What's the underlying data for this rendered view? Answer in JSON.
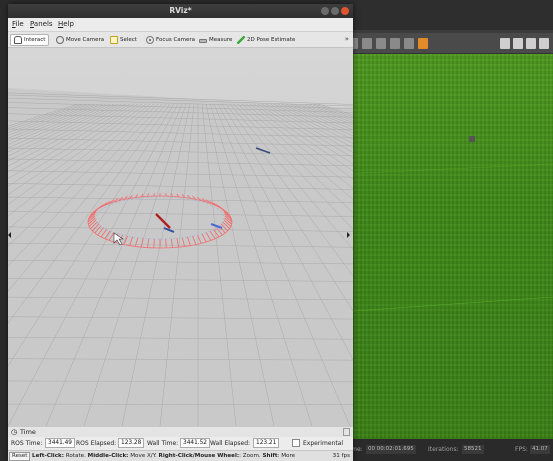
{
  "rviz": {
    "title": "RViz*",
    "menu": [
      {
        "key": "F",
        "rest": "ile"
      },
      {
        "key": "P",
        "rest": "anels"
      },
      {
        "key": "H",
        "rest": "elp"
      }
    ],
    "tools": [
      {
        "label": "Interact",
        "icon": "hand-icon",
        "active": true
      },
      {
        "label": "Move Camera",
        "icon": "move-camera-icon",
        "active": false
      },
      {
        "label": "Select",
        "icon": "select-icon",
        "active": false
      },
      {
        "label": "Focus Camera",
        "icon": "focus-camera-icon",
        "active": false
      },
      {
        "label": "Measure",
        "icon": "measure-icon",
        "active": false
      },
      {
        "label": "2D Pose Estimate",
        "icon": "pose-estimate-icon",
        "active": false
      }
    ],
    "toolbar_more": "»",
    "time_panel": {
      "title": "Time",
      "ros_time_label": "ROS Time:",
      "ros_time": "3441.49",
      "ros_elapsed_label": "ROS Elapsed:",
      "ros_elapsed": "123.28",
      "wall_time_label": "Wall Time:",
      "wall_time": "3441.52",
      "wall_elapsed_label": "Wall Elapsed:",
      "wall_elapsed": "123.21",
      "experimental_label": "Experimental",
      "experimental_checked": false
    },
    "status": {
      "reset_label": "Reset",
      "hint_parts": [
        {
          "text": "Left-Click:",
          "bold": true
        },
        {
          "text": " Rotate. ",
          "bold": false
        },
        {
          "text": "Middle-Click:",
          "bold": true
        },
        {
          "text": " Move X/Y. ",
          "bold": false
        },
        {
          "text": "Right-Click/Mouse Wheel:",
          "bold": true
        },
        {
          "text": ": Zoom. ",
          "bold": false
        },
        {
          "text": "Shift",
          "bold": true
        },
        {
          "text": ": More",
          "bold": false
        }
      ],
      "fps": "31 fps"
    }
  },
  "gazebo": {
    "sim_time_label": "Time:",
    "sim_time": "00 00:02:01.695",
    "iterations_label": "Iterations:",
    "iterations": "58521",
    "fps_label": "FPS:",
    "fps": "41.07",
    "ground_color": "#3f8a18"
  },
  "colors": {
    "laser_scan": "#f07070",
    "pose_arrow": "#b02020",
    "robot_blue": "#3050a0",
    "grid_line": "#a9a9a9"
  }
}
